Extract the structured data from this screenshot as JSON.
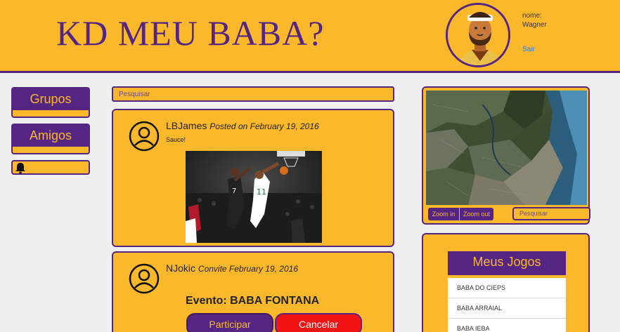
{
  "header": {
    "logo": "KD MEU BABA?",
    "user_label": "nome:",
    "user_name": "Wagner",
    "logout": "Sair"
  },
  "nav": {
    "groups": "Grupos",
    "friends": "Amigos",
    "notifications_icon": "bell-icon"
  },
  "feed": {
    "search_placeholder": "Pesquisar",
    "posts": [
      {
        "author": "LBJames",
        "meta": "Posted on February 19, 2016",
        "text": "Sauce!"
      },
      {
        "author": "NJokic",
        "meta": "Convite February 19, 2016",
        "event": "Evento: BABA FONTANA",
        "join": "Participar",
        "cancel": "Cancelar"
      }
    ]
  },
  "map": {
    "zoom_in": "Zoom in",
    "zoom_out": "Zoom out",
    "search_placeholder": "Pesquisar"
  },
  "games": {
    "title": "Meus Jogos",
    "items": [
      "BABA DO CIEPS",
      "BABA ARRAIAL",
      "BABA IEBA"
    ]
  },
  "colors": {
    "gold": "#fbb82b",
    "purple": "#552583",
    "red": "#f21414"
  }
}
